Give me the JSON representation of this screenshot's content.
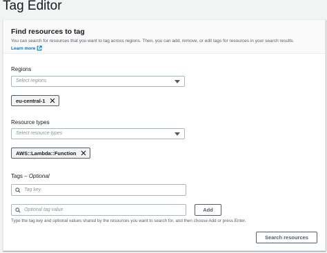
{
  "page": {
    "title": "Tag Editor"
  },
  "panel": {
    "title": "Find resources to tag",
    "description": "You can search for resources that you want to tag across regions. Then, you can add, remove, or edit tags for resources in your search results.",
    "learn_more": "Learn more"
  },
  "regions": {
    "label": "Regions",
    "placeholder": "Select regions",
    "selected": [
      "eu-central-1"
    ]
  },
  "resource_types": {
    "label": "Resource types",
    "placeholder": "Select resource types",
    "selected": [
      "AWS::Lambda::Function"
    ]
  },
  "tags": {
    "label": "Tags",
    "label_optional": "Optional",
    "label_separator": " – ",
    "key_placeholder": "Tag key",
    "value_placeholder": "Optional tag value",
    "add_label": "Add",
    "hint": "Type the tag key and optional values shared by the resources you want to search for, and then choose Add or press Enter."
  },
  "actions": {
    "search_label": "Search resources"
  },
  "icons": {
    "external": "external-link-icon",
    "dismiss": "close-icon",
    "search": "search-icon",
    "dropdown": "caret-down-icon"
  },
  "colors": {
    "link": "#0073bb",
    "text": "#16191f",
    "muted": "#545b64",
    "placeholder": "#879596"
  }
}
